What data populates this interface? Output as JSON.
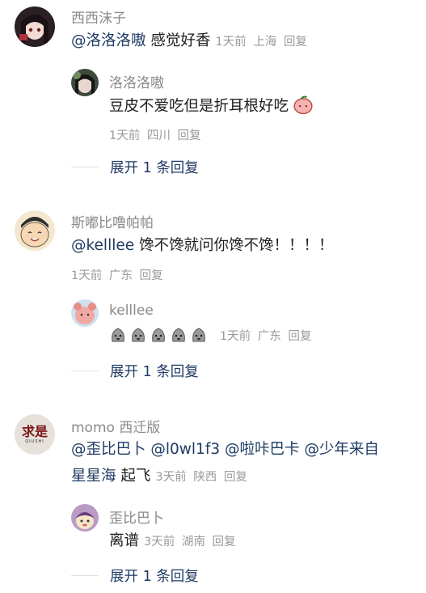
{
  "threads": [
    {
      "author": "西西沫子",
      "mention": "@洛洛洛嗷",
      "text": " 感觉好香",
      "time": "1天前",
      "location": "上海",
      "reply_label": "回复",
      "reply": {
        "author": "洛洛洛嗷",
        "text": "豆皮不爱吃但是折耳根好吃",
        "time": "1天前",
        "location": "四川",
        "reply_label": "回复"
      },
      "expand_label": "展开 1 条回复"
    },
    {
      "author": "斯嘟比噜帕帕",
      "mention": "@kelllee",
      "text": " 馋不馋就问你馋不馋！！！！",
      "time": "1天前",
      "location": "广东",
      "reply_label": "回复",
      "reply": {
        "author": "kelllee",
        "text": "",
        "time": "1天前",
        "location": "广东",
        "reply_label": "回复"
      },
      "expand_label": "展开 1 条回复"
    },
    {
      "author": "momo 西迁版",
      "line1": "@歪比巴卜 @l0wl1f3 @啦咔巴卡 @少年来自",
      "line2_mention": "星星海",
      "line2_text": " 起飞",
      "time": "3天前",
      "location": "陕西",
      "reply_label": "回复",
      "avatar_text": "求是",
      "avatar_sub": "QIUSHI",
      "reply": {
        "author": "歪比巴卜",
        "text": "离谱",
        "time": "3天前",
        "location": "湖南",
        "reply_label": "回复"
      },
      "expand_label": "展开 1 条回复"
    }
  ],
  "colors": {
    "mention": "#1f3b63",
    "meta": "#9a9a9a",
    "name": "#8a8a8a"
  }
}
